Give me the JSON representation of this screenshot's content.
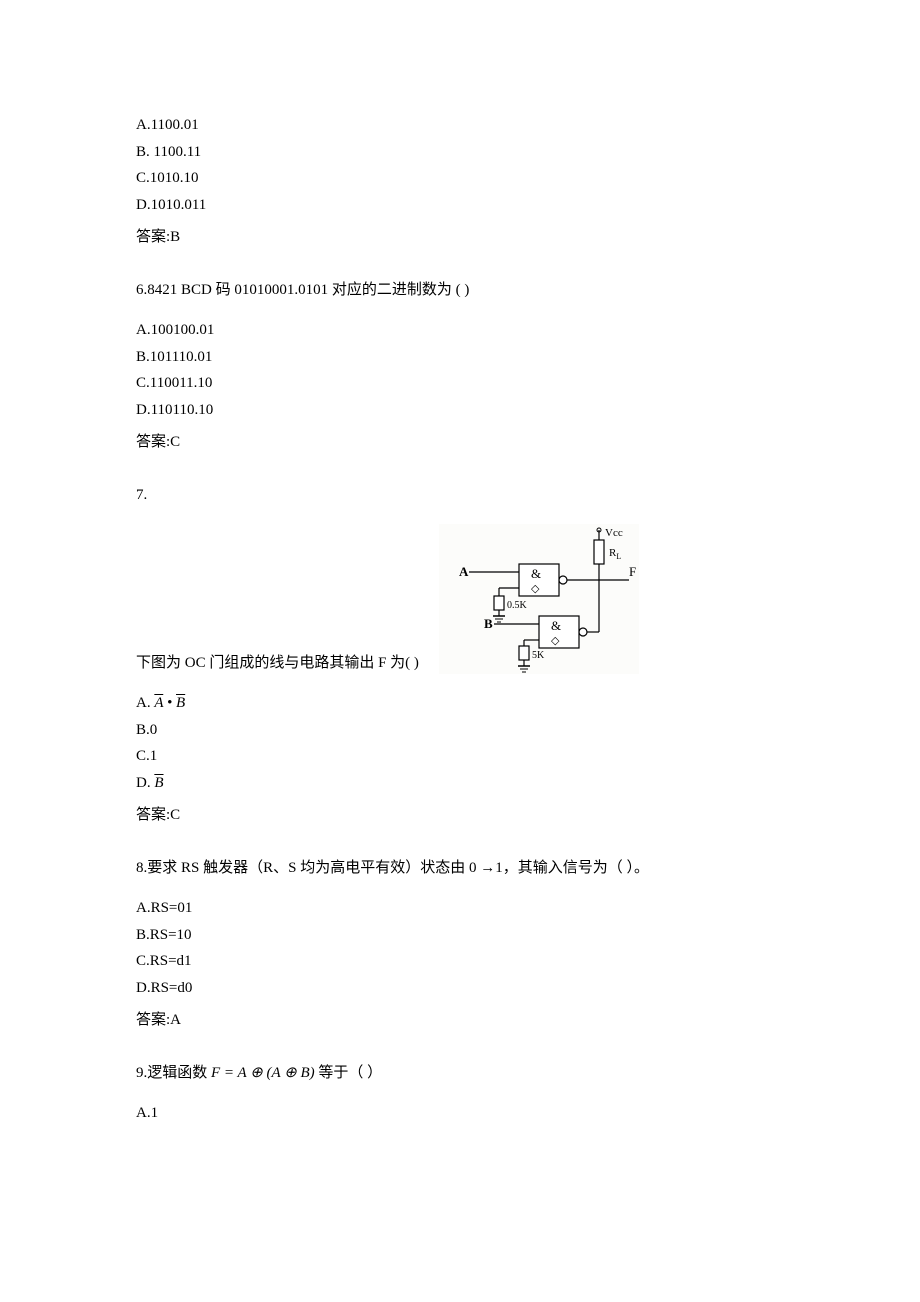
{
  "q5": {
    "optA": "A.1100.01",
    "optB": "B. 1100.11",
    "optC": "C.1010.10",
    "optD": "D.1010.011",
    "answer": "答案:B"
  },
  "q6": {
    "stem": "6.8421 BCD 码 01010001.0101 对应的二进制数为      (            )",
    "optA": "A.100100.01",
    "optB": "B.101110.01",
    "optC": "C.110011.10",
    "optD": "D.110110.10",
    "answer": "答案:C"
  },
  "q7": {
    "number": "7.",
    "stem_prefix": "下图为 OC 门组成的线与电路其输出 F 为(            )",
    "optA_prefix": "A.",
    "optAbar1": "A",
    "optAmid": " • ",
    "optAbar2": "B",
    "optB": "B.0",
    "optC": "C.1",
    "optD_prefix": "D.",
    "optDbar": "B",
    "answer": "答案:C",
    "diagram": {
      "vcc": "Vcc",
      "rl": "R",
      "rl_sub": "L",
      "a": "A",
      "b": "B",
      "f": "F",
      "r1": "0.5K",
      "r2": "5K",
      "gate": "&"
    }
  },
  "q8": {
    "stem": "8.要求 RS 触发器（R、S 均为高电平有效）状态由 0 →1，其输入信号为（         ）。",
    "optA": "A.RS=01",
    "optB": "B.RS=10",
    "optC": "C.RS=d1",
    "optD": "D.RS=d0",
    "answer": "答案:A"
  },
  "q9": {
    "prefix": "9.逻辑函数",
    "formula": "F = A ⊕ (A ⊕ B)",
    "suffix": " 等于（          ）",
    "optA": "A.1"
  }
}
